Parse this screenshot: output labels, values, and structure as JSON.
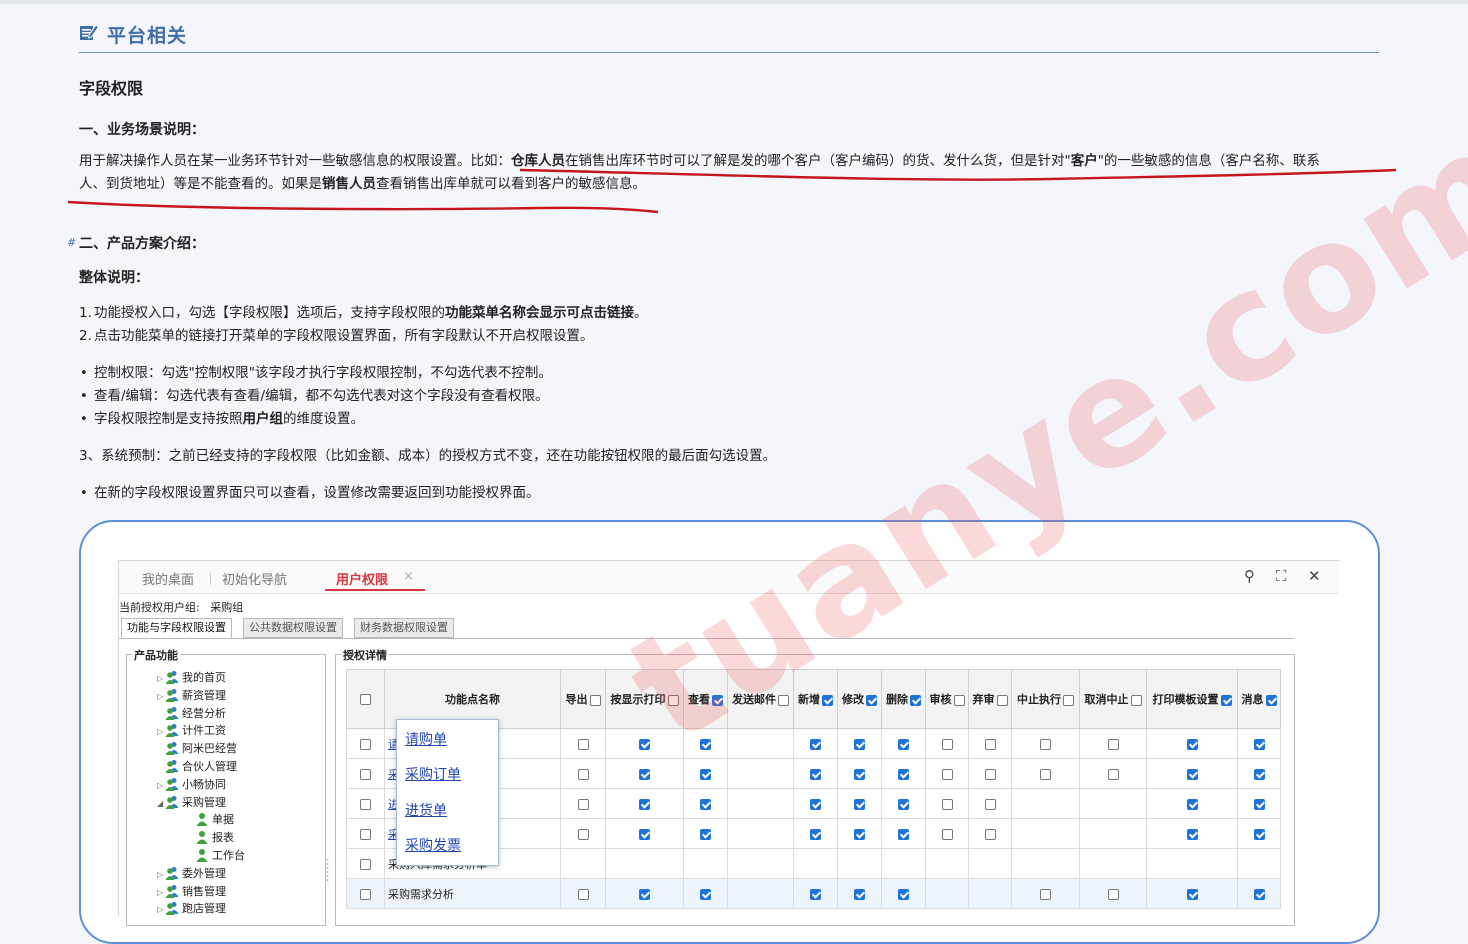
{
  "section_heading": "平台相关",
  "title": "字段权限",
  "scene": {
    "heading": "一、业务场景说明：",
    "line1": [
      "用于解决操作人员在某一业务环节针对一些敏感信息的权限设置。比如：",
      "仓库人员",
      "在销售出库环节时可以了解是发的哪个客户（客户编码）的货、发什么货，但是针对\"",
      "客户",
      "\"的一些敏感的信息（客户名称、联系"
    ],
    "line2": [
      "人、到货地址）等是不能查看的。如果是",
      "销售人员",
      "查看销售出库单就可以看到客户的敏感信息。"
    ]
  },
  "plan": {
    "hash": "#",
    "heading": "二、产品方案介绍：",
    "overall": "整体说明：",
    "numbered": [
      {
        "n": "1.",
        "parts": [
          "功能授权入口，勾选【字段权限】选项后，支持字段权限的",
          "功能菜单名称会显示可点击链接",
          "。"
        ]
      },
      {
        "n": "2.",
        "parts": [
          "点击功能菜单的链接打开菜单的字段权限设置界面，所有字段默认不开启权限设置。"
        ]
      }
    ],
    "bullets": [
      {
        "parts": [
          "控制权限：勾选\"控制权限\"该字段才执行字段权限控制，不勾选代表不控制。"
        ]
      },
      {
        "parts": [
          "查看/编辑：勾选代表有查看/编辑，都不勾选代表对这个字段没有查看权限。"
        ]
      },
      {
        "parts": [
          "字段权限控制是支持按照",
          "用户组",
          "的维度设置。"
        ]
      }
    ],
    "preset": "3、系统预制：之前已经支持的字段权限（比如金额、成本）的授权方式不变，还在功能按钮权限的最后面勾选设置。",
    "bullet2": "在新的字段权限设置界面只可以查看，设置修改需要返回到功能授权界面。"
  },
  "screenshot": {
    "tabs": [
      "我的桌面",
      "初始化导航",
      "用户权限"
    ],
    "close_glyph": "×",
    "tools": [
      "⚲",
      "⛶",
      "✕"
    ],
    "current_group_label": "当前授权用户组:",
    "current_group_value": "采购组",
    "subtabs": [
      "功能与字段权限设置",
      "公共数据权限设置",
      "财务数据权限设置"
    ],
    "left_legend": "产品功能",
    "right_legend": "授权详情",
    "tree": [
      {
        "label": "我的首页",
        "arrow": "▷",
        "level": 0
      },
      {
        "label": "薪资管理",
        "arrow": "▷",
        "level": 0
      },
      {
        "label": "经营分析",
        "arrow": "",
        "level": 0
      },
      {
        "label": "计件工资",
        "arrow": "▷",
        "level": 0
      },
      {
        "label": "阿米巴经营",
        "arrow": "",
        "level": 0
      },
      {
        "label": "合伙人管理",
        "arrow": "",
        "level": 0
      },
      {
        "label": "小畅协同",
        "arrow": "▷",
        "level": 0
      },
      {
        "label": "采购管理",
        "arrow": "◢",
        "level": 0
      },
      {
        "label": "单据",
        "arrow": "",
        "level": 1
      },
      {
        "label": "报表",
        "arrow": "",
        "level": 1
      },
      {
        "label": "工作台",
        "arrow": "",
        "level": 1
      },
      {
        "label": "委外管理",
        "arrow": "▷",
        "level": 0
      },
      {
        "label": "销售管理",
        "arrow": "▷",
        "level": 0
      },
      {
        "label": "跑店管理",
        "arrow": "▷",
        "level": 0
      }
    ],
    "columns": [
      {
        "label": "功能点名称",
        "cb": null
      },
      {
        "label": "导出",
        "cb": false
      },
      {
        "label": "按显示打印",
        "cb": false
      },
      {
        "label": "查看",
        "cb": true
      },
      {
        "label": "发送邮件",
        "cb": false
      },
      {
        "label": "新增",
        "cb": true
      },
      {
        "label": "修改",
        "cb": true
      },
      {
        "label": "删除",
        "cb": true
      },
      {
        "label": "审核",
        "cb": false
      },
      {
        "label": "弃审",
        "cb": false
      },
      {
        "label": "中止执行",
        "cb": false
      },
      {
        "label": "取消中止",
        "cb": false
      },
      {
        "label": "打印模板设置",
        "cb": true
      },
      {
        "label": "消息",
        "cb": true
      }
    ],
    "rows": [
      {
        "name": "请",
        "cells": [
          0,
          1,
          1,
          null,
          1,
          1,
          1,
          0,
          0,
          0,
          0,
          1,
          1
        ]
      },
      {
        "name": "采",
        "cells": [
          0,
          1,
          1,
          null,
          1,
          1,
          1,
          0,
          0,
          0,
          0,
          1,
          1
        ]
      },
      {
        "name": "进",
        "cells": [
          0,
          1,
          1,
          null,
          1,
          1,
          1,
          0,
          0,
          null,
          null,
          1,
          1
        ]
      },
      {
        "name": "采",
        "cells": [
          0,
          1,
          1,
          null,
          1,
          1,
          1,
          0,
          0,
          null,
          null,
          1,
          1
        ]
      },
      {
        "name": "采购入库需求分析单",
        "cells": [
          null,
          null,
          null,
          null,
          null,
          null,
          null,
          null,
          null,
          null,
          null,
          null,
          null
        ]
      },
      {
        "name": "采购需求分析",
        "cells": [
          0,
          1,
          1,
          null,
          1,
          1,
          1,
          null,
          null,
          0,
          0,
          1,
          1
        ]
      }
    ],
    "popup_links": [
      "请购单",
      "采购订单",
      "进货单",
      "采购发票"
    ],
    "watermark": "tuanye.com"
  },
  "colors": {
    "accent": "#3f6ea8",
    "annotation_red": "#c4161c",
    "frame_blue": "#5b8fd6",
    "checkbox_blue": "#1e73d8"
  }
}
